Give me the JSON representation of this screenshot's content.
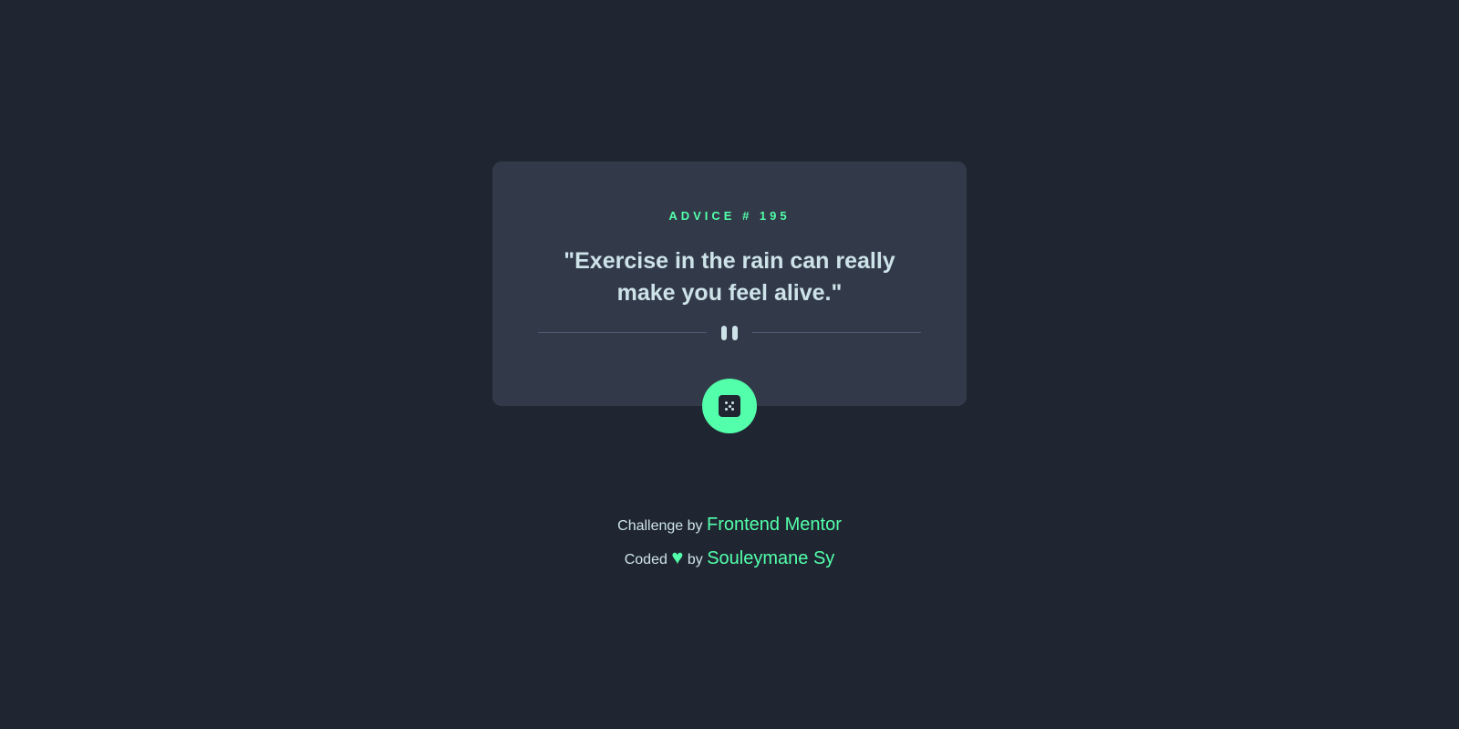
{
  "card": {
    "advice_id": "ADVICE # 195",
    "quote": "\"Exercise in the rain can really make you feel alive.\""
  },
  "dice_button": {
    "icon": "dice-icon"
  },
  "footer": {
    "challenge_text": "Challenge by",
    "challenge_link": "Frontend Mentor",
    "coded_text": "Coded",
    "heart_icon": "♥",
    "by_text": "by",
    "author_link": "Souleymane Sy"
  },
  "colors": {
    "background": "#1f2632",
    "card": "#323a49",
    "accent": "#53ffaa",
    "text": "#cee3e9",
    "divider": "#4f5d74"
  }
}
